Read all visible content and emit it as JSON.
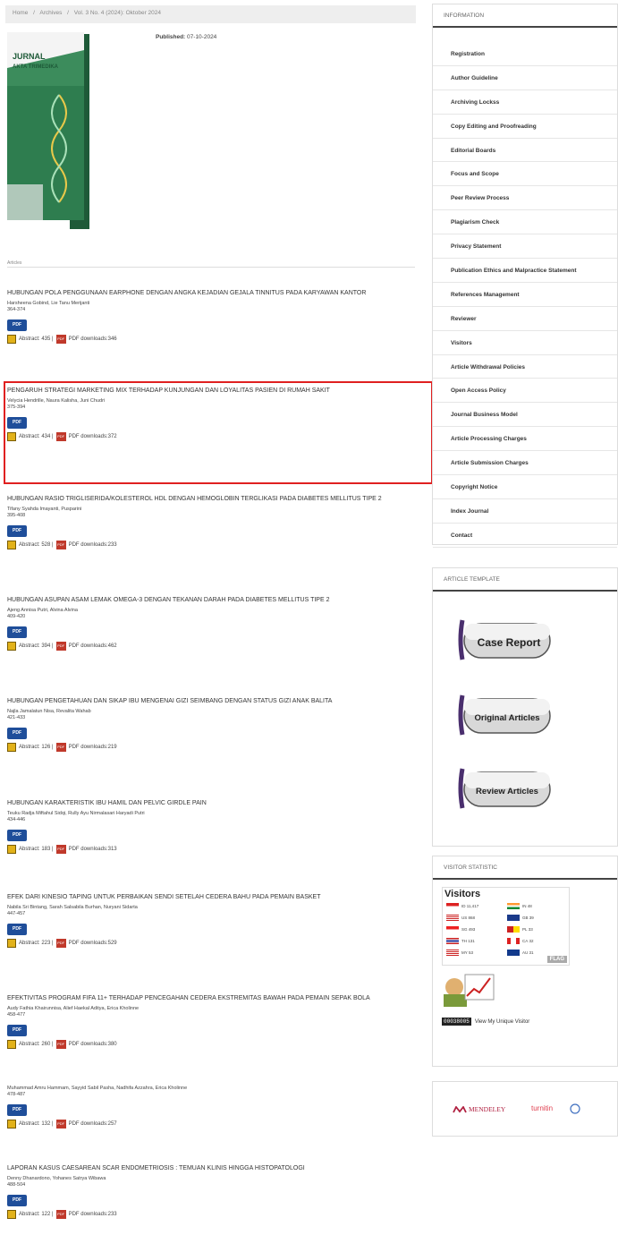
{
  "breadcrumb": {
    "home": "Home",
    "sep": "/",
    "archives": "Archives",
    "current": "Vol. 3 No. 4 (2024): Oktober 2024"
  },
  "issue": {
    "published_label": "Published:",
    "published_date": "07-10-2024",
    "cover": {
      "line1": "JURNAL",
      "line2": "AKTA TRIMEDIKA",
      "bg": "#2e7d4f"
    }
  },
  "toc_label": "Articles",
  "articles": [
    {
      "title": "HUBUNGAN POLA PENGGUNAAN EARPHONE DENGAN ANGKA KEJADIAN GEJALA TINNITUS PADA KARYAWAN KANTOR",
      "authors": "Harsheena Gobind, Lie Tanu Merijanti",
      "pages": "364-374",
      "pdf": "PDF",
      "abstract": "Abstract: 435",
      "downloads": "PDF downloads:346"
    },
    {
      "title": "PENGARUH STRATEGI MARKETING MIX TERHADAP KUNJUNGAN DAN LOYALITAS PASIEN DI RUMAH SAKIT",
      "authors": "Velycia Hendrille, Naura Kalisha, Juni Chudri",
      "pages": "375-394",
      "pdf": "PDF",
      "abstract": "Abstract: 434",
      "downloads": "PDF downloads:372"
    },
    {
      "title": "HUBUNGAN RASIO TRIGLISERIDA/KOLESTEROL HDL DENGAN HEMOGLOBIN TERGLIKASI PADA DIABETES MELLITUS TIPE 2",
      "authors": "Tifany Syahda Imayanti, Puspari​ni",
      "pages": "395-408",
      "pdf": "PDF",
      "abstract": "Abstract: 528",
      "downloads": "PDF downloads:233"
    },
    {
      "title": "HUBUNGAN ASUPAN ASAM LEMAK OMEGA-3 DENGAN TEKANAN DARAH PADA DIABETES MELLITUS TIPE 2",
      "authors": "Ajeng Annisa Putri, Alvina Alvina",
      "pages": "409-420",
      "pdf": "PDF",
      "abstract": "Abstract: 394",
      "downloads": "PDF downloads:462"
    },
    {
      "title": "HUBUNGAN PENGETAHUAN DAN SIKAP IBU MENGENAI GIZI SEIMBANG DENGAN STATUS GIZI ANAK BALITA",
      "authors": "Najla Jamalatun Nisa, Revalita Wahab",
      "pages": "421-433",
      "pdf": "PDF",
      "abstract": "Abstract: 126",
      "downloads": "PDF downloads:219"
    },
    {
      "title": "HUBUNGAN KARAKTERISTIK IBU HAMIL DAN PELVIC GIRDLE PAIN",
      "authors": "Teuku Radja Miftahul Sidqi, Rully Ayu Nirmalasari Haryadi Putri",
      "pages": "434-446",
      "pdf": "PDF",
      "abstract": "Abstract: 183",
      "downloads": "PDF downloads:313"
    },
    {
      "title": "EFEK DARI KINESIO TAPING UNTUK PERBAIKAN SENDI SETELAH CEDERA BAHU PADA PEMAIN BASKET",
      "authors": "Nabila Sri Bintang, Sarah Salsabila Burhan, Nuryani Sidarta",
      "pages": "447-457",
      "pdf": "PDF",
      "abstract": "Abstract: 223",
      "downloads": "PDF downloads:529"
    },
    {
      "title": "EFEKTIVITAS PROGRAM FIFA 11+ TERHADAP PENCEGAHAN CEDERA EKSTREMITAS BAWAH PADA PEMAIN SEPAK BOLA",
      "authors": "Audy Fathia Khairunnisa, Alief Haekal Aditya, Erica Kholinne",
      "pages": "458-477",
      "pdf": "PDF",
      "abstract": "Abstract: 260",
      "downloads": "PDF downloads:380"
    },
    {
      "title": "",
      "authors": "Muhammad Amru Hammam, Sayyid Sabil Pasha, Nadhifa Azzahra, Erica Kholinne",
      "pages": "478-487",
      "pdf": "PDF",
      "abstract": "Abstract: 132",
      "downloads": "PDF downloads:257"
    },
    {
      "title": "LAPORAN KASUS CAESAREAN SCAR ENDOMETRIOSIS : TEMUAN KLINIS HINGGA HISTOPATOLOGI",
      "authors": "Denny Dhanardono, Yohanes Satrya Wibawa",
      "pages": "488-504",
      "pdf": "PDF",
      "abstract": "Abstract: 122",
      "downloads": "PDF downloads:233"
    }
  ],
  "sidebar": {
    "information": {
      "heading": "INFORMATION",
      "items": [
        "Registration",
        "Author Guideline",
        "Archiving Lockss",
        "Copy Editing and Proofreading",
        "Editorial Boards",
        "Focus and Scope",
        "Peer Review Process",
        "Plagiarism Check",
        "Privacy Statement",
        "Publication Ethics and Malpractice Statement",
        "References Management",
        "Reviewer",
        "Visitors",
        "Article Withdrawal Policies",
        "Open Access Policy",
        "Journal Business Model",
        "Article Processing Charges",
        "Article Submission Charges",
        "Copyright Notice",
        "Index Journal",
        "Contact"
      ]
    },
    "template": {
      "heading": "ARTICLE TEMPLATE",
      "buttons": [
        "Case Report",
        "Original Articles",
        "Review Articles"
      ]
    },
    "visitor": {
      "heading": "VISITOR STATISTIC",
      "title": "Visitors",
      "rows": [
        [
          "ID",
          "11,417",
          "IN",
          "48"
        ],
        [
          "US",
          "868",
          "GB",
          "39"
        ],
        [
          "SG",
          "493",
          "PL",
          "33"
        ],
        [
          "TH",
          "131",
          "CA",
          "32"
        ],
        [
          "MY",
          "53",
          "AU",
          "31"
        ]
      ],
      "flagcounter": "FLAG",
      "counter_digits": "00038005",
      "unique_link": "View My Unique Visitor"
    },
    "partners": {
      "mendeley": "MENDELEY",
      "turnitin": "turnitin"
    }
  },
  "colors": {
    "highlight": "#e02020",
    "pdf_button": "#1f4e9a"
  }
}
